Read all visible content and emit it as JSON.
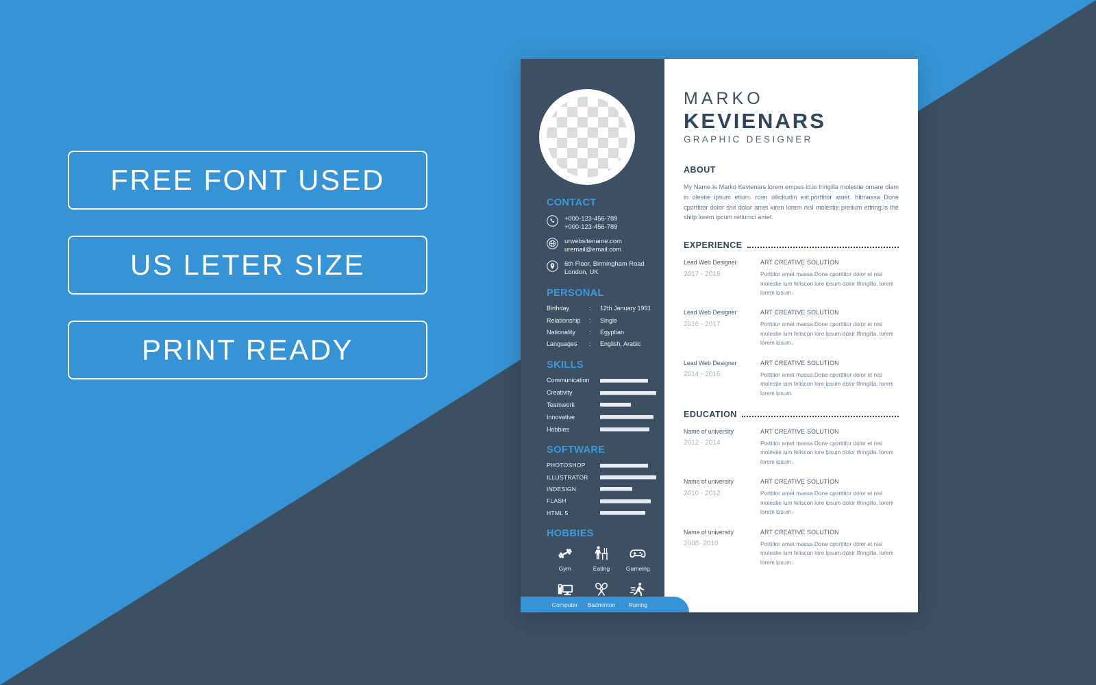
{
  "background": {
    "blue": "#3694d6",
    "dark": "#3c4f63"
  },
  "promo": {
    "badges": [
      {
        "label": "FREE FONT USED"
      },
      {
        "label": "US LETER SIZE"
      },
      {
        "label": "PRINT READY"
      }
    ]
  },
  "resume": {
    "header": {
      "first_name": "MARKO",
      "last_name": "KEVIENARS",
      "job_title": "GRAPHIC DESIGNER",
      "avatar": "photo-placeholder"
    },
    "sidebar": {
      "contact": {
        "heading": "CONTACT",
        "items": [
          {
            "icon": "phone-icon",
            "line1": "+000-123-456-789",
            "line2": "+000-123-456-789"
          },
          {
            "icon": "globe-icon",
            "line1": "urwebsitename.com",
            "line2": "uremail@email.com"
          },
          {
            "icon": "location-pin-icon",
            "line1": "6th Floor, Birmingham Road",
            "line2": "London, UK"
          }
        ]
      },
      "personal": {
        "heading": "PERSONAL",
        "separator": ":",
        "rows": [
          {
            "key": "Birthday",
            "value": "12th January 1991"
          },
          {
            "key": "Relationship",
            "value": "Single"
          },
          {
            "key": "Nationality",
            "value": "Egyptian"
          },
          {
            "key": "Languages",
            "value": "English, Arabic"
          }
        ]
      },
      "skills": {
        "heading": "SKILLS",
        "items": [
          {
            "label": "Communication",
            "level": 85
          },
          {
            "label": "Creativity",
            "level": 100
          },
          {
            "label": "Teamwork",
            "level": 55
          },
          {
            "label": "Innovative",
            "level": 95
          },
          {
            "label": "Hobbies",
            "level": 88
          }
        ]
      },
      "software": {
        "heading": "SOFTWARE",
        "items": [
          {
            "label": "PHOTOSHOP",
            "level": 85
          },
          {
            "label": "ILLUSTRATOR",
            "level": 100
          },
          {
            "label": "INDESIGN",
            "level": 57
          },
          {
            "label": "FLASH",
            "level": 90
          },
          {
            "label": "HTML 5",
            "level": 80
          }
        ]
      },
      "hobbies": {
        "heading": "HOBBIES",
        "items": [
          {
            "icon": "dumbbell-icon",
            "label": "Gym"
          },
          {
            "icon": "eating-icon",
            "label": "Eating"
          },
          {
            "icon": "gamepad-icon",
            "label": "Gameing"
          },
          {
            "icon": "computer-icon",
            "label": "Computer"
          },
          {
            "icon": "badminton-icon",
            "label": "Badminton"
          },
          {
            "icon": "running-icon",
            "label": "Runing"
          }
        ]
      }
    },
    "main": {
      "about": {
        "heading": "ABOUT",
        "text": "My Name Is Marko Kevienars lorem empus id.is fringilla molestie ornare diam in olestie ipsum etium. rosn ollicitudin est,porttitor amet. hitmassa Done cporttitor dolor shit dolor amet kiren lorem nisl molestie pretium etfring.is the shitp lorem ipcum retiumci amet."
      },
      "experience": {
        "heading": "EXPERIENCE",
        "entries": [
          {
            "role": "Lead  Web Designer",
            "date": "2017 - 2018",
            "org": "ART CREATIVE SOLUTION",
            "desc": "Porttitor amet massa Done cporttitor dolor et nisl molestie ium feliscon lore  ipsum dolor tfringilla. lorem lorem ipsum."
          },
          {
            "role": "Lead  Web Designer",
            "date": "2016 - 2017",
            "org": "ART CREATIVE SOLUTION",
            "desc": "Porttitor amet massa Done cporttitor dolor et nisl molestie ium feliscon lore  ipsum dolor tfringilla. lorem lorem ipsum."
          },
          {
            "role": "Lead  Web Designer",
            "date": "2014 - 2016",
            "org": "ART CREATIVE SOLUTION",
            "desc": "Porttitor amet massa Done cporttitor dolor et nisl molestie ium feliscon lore  ipsum dolor tfringilla. lorem lorem ipsum."
          }
        ]
      },
      "education": {
        "heading": "EDUCATION",
        "entries": [
          {
            "role": "Name of university",
            "date": "2012 - 2014",
            "org": "ART CREATIVE SOLUTION",
            "desc": "Porttitor amet massa Done cporttitor dolor et nisl molestie ium feliscon lore  ipsum dolor tfringilla. lorem lorem ipsum."
          },
          {
            "role": "Name of university",
            "date": "2010 - 2012",
            "org": "ART CREATIVE SOLUTION",
            "desc": "Porttitor amet massa Done cporttitor dolor et nisl molestie ium feliscon lore  ipsum dolor tfringilla. lorem lorem ipsum."
          },
          {
            "role": "Name of university",
            "date": "2008- 2010",
            "org": "ART CREATIVE SOLUTION",
            "desc": "Porttitor amet massa Done cporttitor dolor et nisl molestie ium feliscon lore  ipsum dolor tfringilla. lorem lorem ipsum."
          }
        ]
      }
    }
  }
}
